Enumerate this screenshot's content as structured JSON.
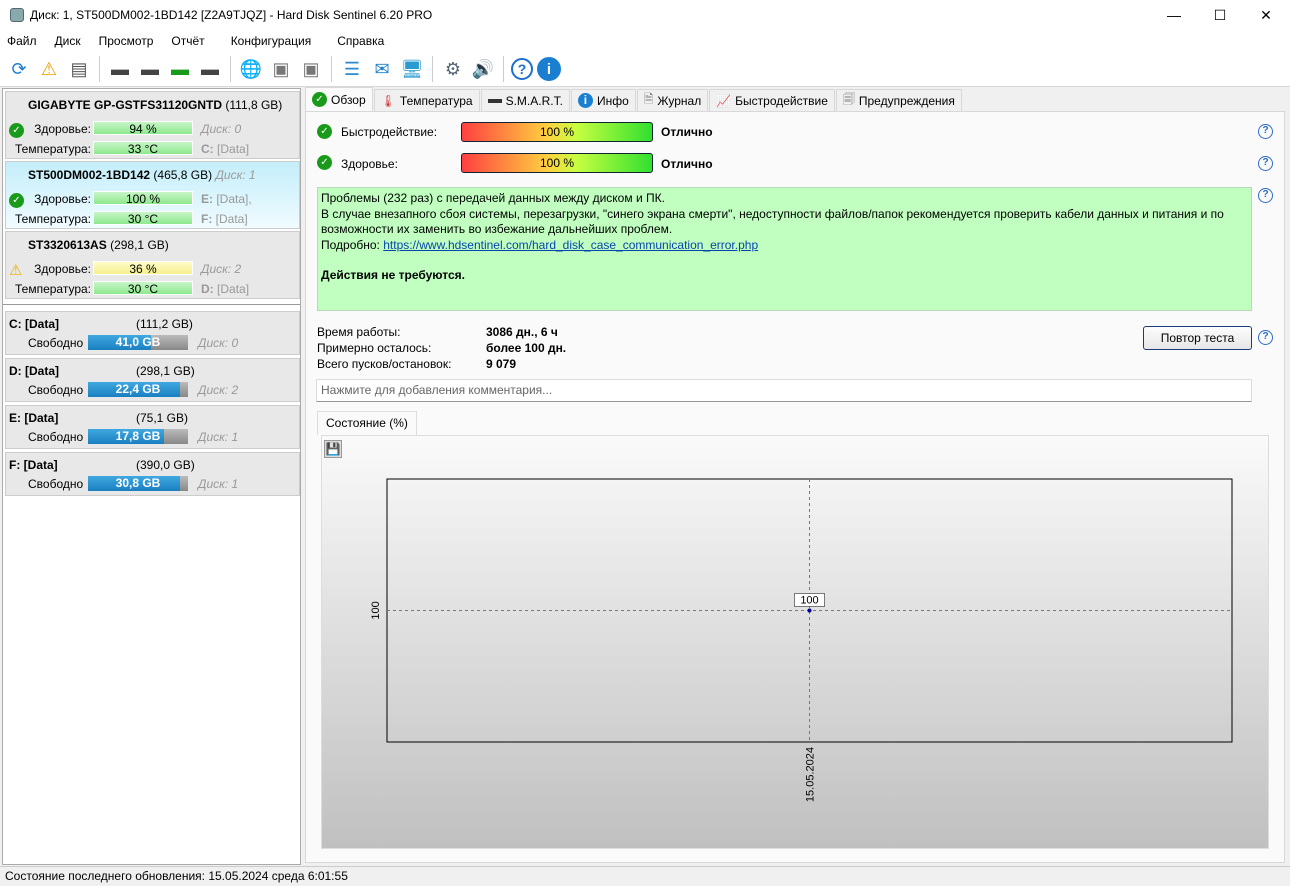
{
  "window": {
    "title": "Диск: 1, ST500DM002-1BD142 [Z2A9TJQZ]  -  Hard Disk Sentinel 6.20 PRO"
  },
  "menu": [
    "Файл",
    "Диск",
    "Просмотр",
    "Отчёт",
    "Конфигурация",
    "Справка"
  ],
  "toolbar": [
    "refresh-icon",
    "refresh-warning-icon",
    "disk-info-icon",
    "disk-sound-icon",
    "disk-schedule-icon",
    "disk-test-ok-icon",
    "disk-search-icon",
    "network-disk-icon",
    "external-disk-icon",
    "disk-drive-icon",
    "report-icon",
    "email-icon",
    "web-monitor-icon",
    "settings-icon",
    "sound-icon",
    "help-icon",
    "info-icon"
  ],
  "disks": [
    {
      "name": "GIGABYTE GP-GSTFS31120GNTD",
      "size": "(111,8 GB)",
      "health_label": "Здоровье:",
      "health": "94 %",
      "health_value": 94,
      "temp_label": "Температура:",
      "temp": "33 °C",
      "disk": "Диск: 0",
      "drives": [
        "C:",
        "[Data]"
      ],
      "status": "ok"
    },
    {
      "name": "ST500DM002-1BD142",
      "size": "(465,8 GB)",
      "health_label": "Здоровье:",
      "health": "100 %",
      "health_value": 100,
      "temp_label": "Температура:",
      "temp": "30 °C",
      "disk": "Диск: 1",
      "drives": [
        "E:",
        "[Data],",
        "F:",
        "[Data]"
      ],
      "status": "ok",
      "selected": true
    },
    {
      "name": "ST3320613AS",
      "size": "(298,1 GB)",
      "health_label": "Здоровье:",
      "health": "36 %",
      "health_value": 36,
      "temp_label": "Температура:",
      "temp": "30 °C",
      "disk": "Диск: 2",
      "drives": [
        "D:",
        "[Data]"
      ],
      "status": "warning"
    }
  ],
  "partitions": [
    {
      "name": "C: [Data]",
      "size": "(111,2 GB)",
      "free_label": "Свободно",
      "free": "41,0 GB",
      "used_pct": 63,
      "disk": "Диск: 0"
    },
    {
      "name": "D: [Data]",
      "size": "(298,1 GB)",
      "free_label": "Свободно",
      "free": "22,4 GB",
      "used_pct": 92,
      "disk": "Диск: 2"
    },
    {
      "name": "E: [Data]",
      "size": "(75,1 GB)",
      "free_label": "Свободно",
      "free": "17,8 GB",
      "used_pct": 76,
      "disk": "Диск: 1"
    },
    {
      "name": "F: [Data]",
      "size": "(390,0 GB)",
      "free_label": "Свободно",
      "free": "30,8 GB",
      "used_pct": 92,
      "disk": "Диск: 1"
    }
  ],
  "tabs": [
    "Обзор",
    "Температура",
    "S.M.A.R.T.",
    "Инфо",
    "Журнал",
    "Быстродействие",
    "Предупреждения"
  ],
  "overview": {
    "perf_label": "Быстродействие:",
    "perf": "100 %",
    "perf_value": 100,
    "perf_rating": "Отлично",
    "health_label": "Здоровье:",
    "health": "100 %",
    "health_value": 100,
    "health_rating": "Отлично",
    "info_lines": [
      "Проблемы (232 раз) с передачей данных между диском и ПК.",
      "В случае внезапного сбоя системы, перезагрузки, \"синего экрана смерти\", недоступности файлов/папок рекомендуется проверить кабели данных и питания и по возможности их заменить во избежание дальнейших проблем."
    ],
    "details_label": "Подробно:",
    "details_link": "https://www.hdsentinel.com/hard_disk_case_communication_error.php",
    "action": "Действия не требуются.",
    "uptime_label": "Время работы:",
    "uptime": "3086 дн., 6 ч",
    "remaining_label": "Примерно осталось:",
    "remaining": "более 100 дн.",
    "starts_label": "Всего пусков/остановок:",
    "starts": "9 079",
    "retest": "Повтор теста",
    "comment_placeholder": "Нажмите для добавления комментария...",
    "chart_tab": "Состояние (%)"
  },
  "chart_data": {
    "type": "line",
    "x": [
      "15.05.2024"
    ],
    "values": [
      100
    ],
    "y_ticks": [
      "100"
    ],
    "x_ticks": [
      "15.05.2024"
    ],
    "data_labels": [
      "100"
    ],
    "grid": true
  },
  "status": "Состояние последнего обновления: 15.05.2024 среда 6:01:55"
}
